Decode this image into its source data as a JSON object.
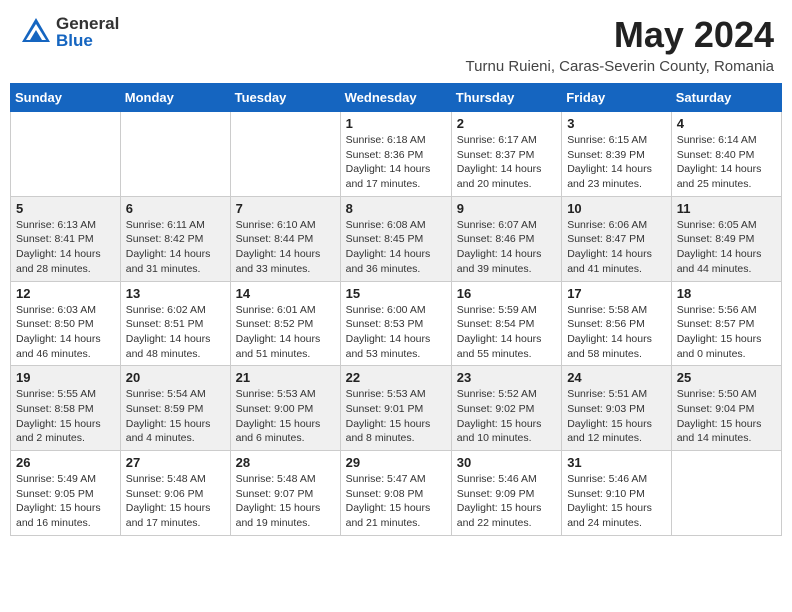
{
  "header": {
    "logo_general": "General",
    "logo_blue": "Blue",
    "month_title": "May 2024",
    "location": "Turnu Ruieni, Caras-Severin County, Romania"
  },
  "weekdays": [
    "Sunday",
    "Monday",
    "Tuesday",
    "Wednesday",
    "Thursday",
    "Friday",
    "Saturday"
  ],
  "weeks": [
    [
      {
        "day": "",
        "info": ""
      },
      {
        "day": "",
        "info": ""
      },
      {
        "day": "",
        "info": ""
      },
      {
        "day": "1",
        "info": "Sunrise: 6:18 AM\nSunset: 8:36 PM\nDaylight: 14 hours\nand 17 minutes."
      },
      {
        "day": "2",
        "info": "Sunrise: 6:17 AM\nSunset: 8:37 PM\nDaylight: 14 hours\nand 20 minutes."
      },
      {
        "day": "3",
        "info": "Sunrise: 6:15 AM\nSunset: 8:39 PM\nDaylight: 14 hours\nand 23 minutes."
      },
      {
        "day": "4",
        "info": "Sunrise: 6:14 AM\nSunset: 8:40 PM\nDaylight: 14 hours\nand 25 minutes."
      }
    ],
    [
      {
        "day": "5",
        "info": "Sunrise: 6:13 AM\nSunset: 8:41 PM\nDaylight: 14 hours\nand 28 minutes."
      },
      {
        "day": "6",
        "info": "Sunrise: 6:11 AM\nSunset: 8:42 PM\nDaylight: 14 hours\nand 31 minutes."
      },
      {
        "day": "7",
        "info": "Sunrise: 6:10 AM\nSunset: 8:44 PM\nDaylight: 14 hours\nand 33 minutes."
      },
      {
        "day": "8",
        "info": "Sunrise: 6:08 AM\nSunset: 8:45 PM\nDaylight: 14 hours\nand 36 minutes."
      },
      {
        "day": "9",
        "info": "Sunrise: 6:07 AM\nSunset: 8:46 PM\nDaylight: 14 hours\nand 39 minutes."
      },
      {
        "day": "10",
        "info": "Sunrise: 6:06 AM\nSunset: 8:47 PM\nDaylight: 14 hours\nand 41 minutes."
      },
      {
        "day": "11",
        "info": "Sunrise: 6:05 AM\nSunset: 8:49 PM\nDaylight: 14 hours\nand 44 minutes."
      }
    ],
    [
      {
        "day": "12",
        "info": "Sunrise: 6:03 AM\nSunset: 8:50 PM\nDaylight: 14 hours\nand 46 minutes."
      },
      {
        "day": "13",
        "info": "Sunrise: 6:02 AM\nSunset: 8:51 PM\nDaylight: 14 hours\nand 48 minutes."
      },
      {
        "day": "14",
        "info": "Sunrise: 6:01 AM\nSunset: 8:52 PM\nDaylight: 14 hours\nand 51 minutes."
      },
      {
        "day": "15",
        "info": "Sunrise: 6:00 AM\nSunset: 8:53 PM\nDaylight: 14 hours\nand 53 minutes."
      },
      {
        "day": "16",
        "info": "Sunrise: 5:59 AM\nSunset: 8:54 PM\nDaylight: 14 hours\nand 55 minutes."
      },
      {
        "day": "17",
        "info": "Sunrise: 5:58 AM\nSunset: 8:56 PM\nDaylight: 14 hours\nand 58 minutes."
      },
      {
        "day": "18",
        "info": "Sunrise: 5:56 AM\nSunset: 8:57 PM\nDaylight: 15 hours\nand 0 minutes."
      }
    ],
    [
      {
        "day": "19",
        "info": "Sunrise: 5:55 AM\nSunset: 8:58 PM\nDaylight: 15 hours\nand 2 minutes."
      },
      {
        "day": "20",
        "info": "Sunrise: 5:54 AM\nSunset: 8:59 PM\nDaylight: 15 hours\nand 4 minutes."
      },
      {
        "day": "21",
        "info": "Sunrise: 5:53 AM\nSunset: 9:00 PM\nDaylight: 15 hours\nand 6 minutes."
      },
      {
        "day": "22",
        "info": "Sunrise: 5:53 AM\nSunset: 9:01 PM\nDaylight: 15 hours\nand 8 minutes."
      },
      {
        "day": "23",
        "info": "Sunrise: 5:52 AM\nSunset: 9:02 PM\nDaylight: 15 hours\nand 10 minutes."
      },
      {
        "day": "24",
        "info": "Sunrise: 5:51 AM\nSunset: 9:03 PM\nDaylight: 15 hours\nand 12 minutes."
      },
      {
        "day": "25",
        "info": "Sunrise: 5:50 AM\nSunset: 9:04 PM\nDaylight: 15 hours\nand 14 minutes."
      }
    ],
    [
      {
        "day": "26",
        "info": "Sunrise: 5:49 AM\nSunset: 9:05 PM\nDaylight: 15 hours\nand 16 minutes."
      },
      {
        "day": "27",
        "info": "Sunrise: 5:48 AM\nSunset: 9:06 PM\nDaylight: 15 hours\nand 17 minutes."
      },
      {
        "day": "28",
        "info": "Sunrise: 5:48 AM\nSunset: 9:07 PM\nDaylight: 15 hours\nand 19 minutes."
      },
      {
        "day": "29",
        "info": "Sunrise: 5:47 AM\nSunset: 9:08 PM\nDaylight: 15 hours\nand 21 minutes."
      },
      {
        "day": "30",
        "info": "Sunrise: 5:46 AM\nSunset: 9:09 PM\nDaylight: 15 hours\nand 22 minutes."
      },
      {
        "day": "31",
        "info": "Sunrise: 5:46 AM\nSunset: 9:10 PM\nDaylight: 15 hours\nand 24 minutes."
      },
      {
        "day": "",
        "info": ""
      }
    ]
  ]
}
